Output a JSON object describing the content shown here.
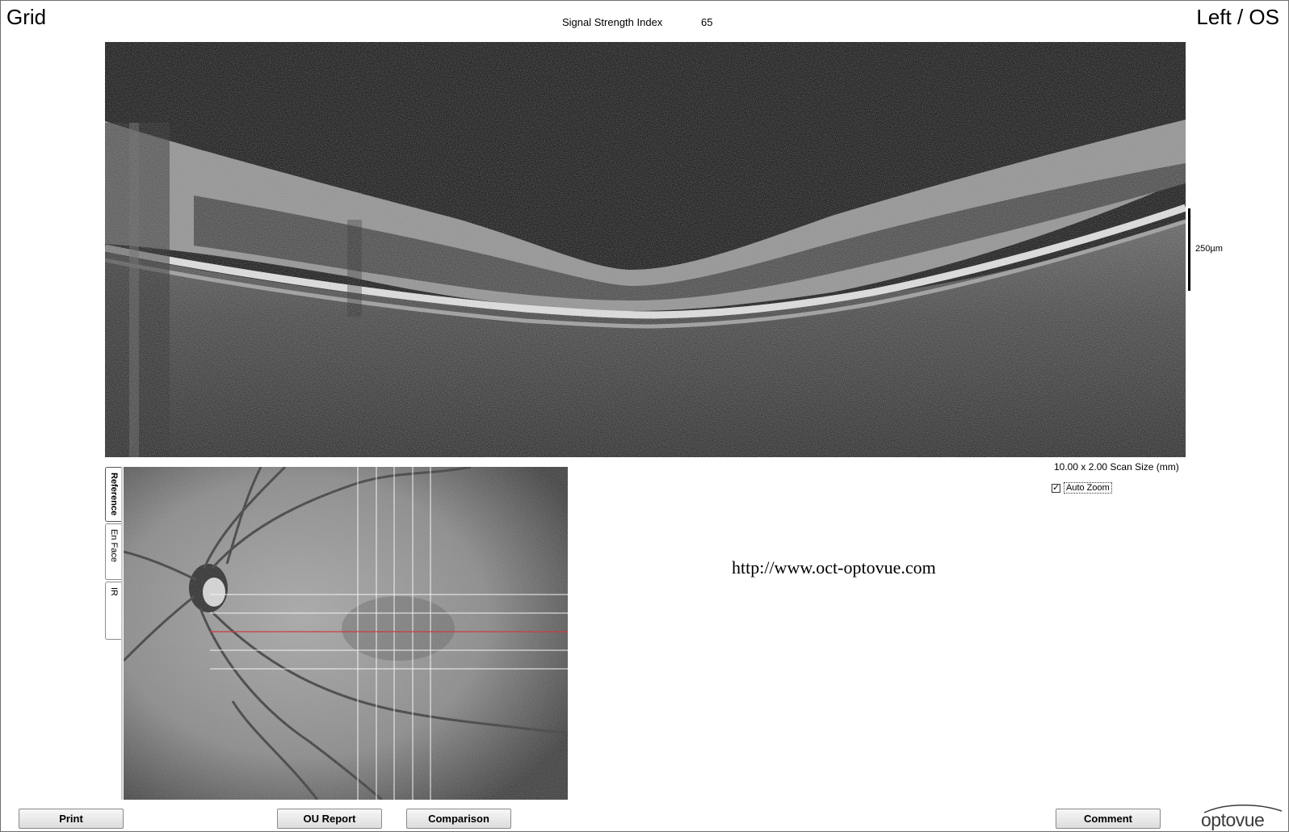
{
  "header": {
    "scan_type": "Grid",
    "eye": "Left / OS",
    "ssi_label": "Signal Strength Index",
    "ssi_value": "65"
  },
  "bscan": {
    "scale_label": "250µm",
    "scan_size": "10.00 x 2.00 Scan Size (mm)",
    "auto_zoom_label": "Auto Zoom",
    "auto_zoom_checked": true
  },
  "reference_tabs": [
    {
      "label": "Reference",
      "active": true
    },
    {
      "label": "En Face",
      "active": false
    },
    {
      "label": "IR",
      "active": false
    }
  ],
  "fundus": {
    "grid_line_color": "#ffffff",
    "selected_line_color": "#d0202a"
  },
  "watermark_url": "http://www.oct-optovue.com",
  "buttons": {
    "print": "Print",
    "ou_report": "OU Report",
    "comparison": "Comparison",
    "comment": "Comment"
  },
  "logo": {
    "text": "optovue",
    "accent_color": "#1e5fa8"
  }
}
